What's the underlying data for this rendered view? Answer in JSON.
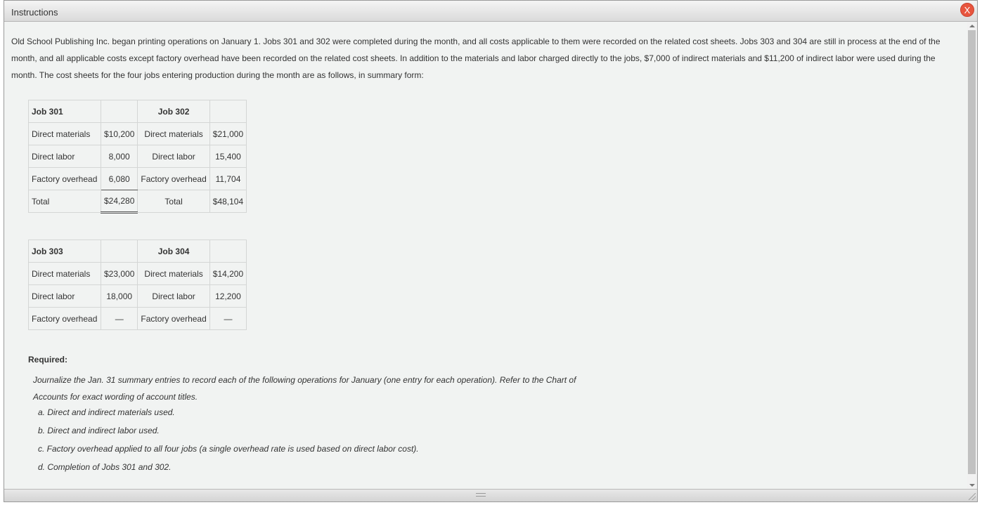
{
  "window": {
    "title": "Instructions",
    "close_label": "X"
  },
  "intro": "Old School Publishing Inc. began printing operations on January 1. Jobs 301 and 302 were completed during the month, and all costs applicable to them were recorded on the related cost sheets. Jobs 303 and 304 are still in process at the end of the month, and all applicable costs except factory overhead have been recorded on the related cost sheets. In addition to the materials and labor charged directly to the jobs, $7,000 of indirect materials and $11,200 of indirect labor were used during the month. The cost sheets for the four jobs entering production during the month are as follows, in summary form:",
  "table1": {
    "job_a": "Job 301",
    "job_b": "Job 302",
    "rows": [
      {
        "label_a": "Direct materials",
        "value_a": "$10,200",
        "label_b": "Direct materials",
        "value_b": "$21,000"
      },
      {
        "label_a": "Direct labor",
        "value_a": "8,000",
        "label_b": "Direct labor",
        "value_b": "15,400"
      },
      {
        "label_a": "Factory overhead",
        "value_a": "6,080",
        "label_b": "Factory overhead",
        "value_b": "11,704"
      },
      {
        "label_a": "Total",
        "value_a": "$24,280",
        "label_b": "Total",
        "value_b": "$48,104"
      }
    ]
  },
  "table2": {
    "job_a": "Job 303",
    "job_b": "Job 304",
    "rows": [
      {
        "label_a": "Direct materials",
        "value_a": "$23,000",
        "label_b": "Direct materials",
        "value_b": "$14,200"
      },
      {
        "label_a": "Direct labor",
        "value_a": "18,000",
        "label_b": "Direct labor",
        "value_b": "12,200"
      },
      {
        "label_a": "Factory overhead",
        "value_a": "—",
        "label_b": "Factory overhead",
        "value_b": "—"
      }
    ]
  },
  "required": {
    "title": "Required:",
    "body": "Journalize the Jan. 31 summary entries to record each of the following operations for January (one entry for each operation). Refer to the Chart of Accounts for exact wording of account titles.",
    "items": [
      "a. Direct and indirect materials used.",
      "b. Direct and indirect labor used.",
      "c. Factory overhead applied to all four jobs (a single overhead rate is used based on direct labor cost).",
      "d. Completion of Jobs 301 and 302."
    ]
  }
}
